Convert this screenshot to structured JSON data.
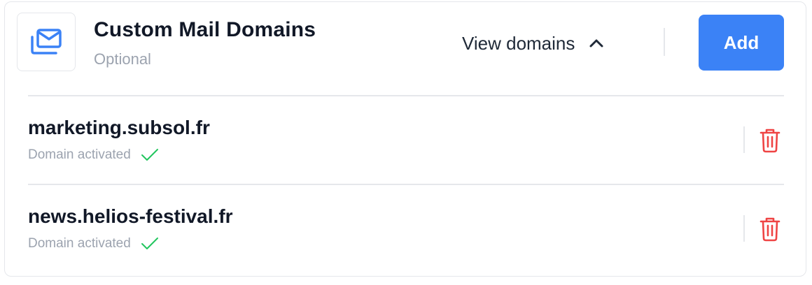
{
  "header": {
    "title": "Custom Mail Domains",
    "subtitle": "Optional",
    "view_domains_label": "View domains",
    "add_label": "Add"
  },
  "domains": [
    {
      "name": "marketing.subsol.fr",
      "status": "Domain activated"
    },
    {
      "name": "news.helios-festival.fr",
      "status": "Domain activated"
    }
  ],
  "colors": {
    "accent": "#3b82f6",
    "success": "#22c55e",
    "danger": "#ef4444",
    "muted_text": "#9ca3af",
    "border": "#e5e7eb"
  },
  "icons": {
    "header": "mail-stack-icon",
    "toggle": "chevron-up-icon",
    "status": "check-icon",
    "delete": "trash-icon"
  }
}
